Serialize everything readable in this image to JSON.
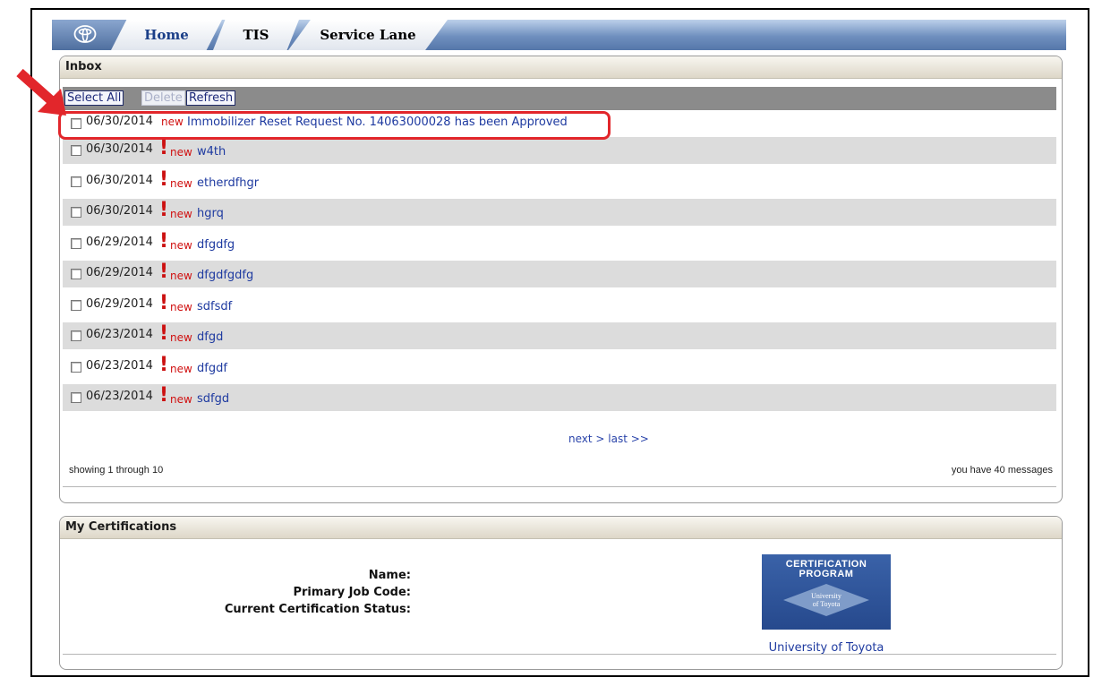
{
  "nav": {
    "logo_icon": "toyota-logo-icon",
    "tabs": [
      {
        "label": "Home",
        "active": true
      },
      {
        "label": "TIS",
        "active": false
      },
      {
        "label": "Service Lane",
        "active": false
      }
    ]
  },
  "inbox": {
    "title": "Inbox",
    "toolbar": {
      "select_all": "Select All",
      "delete": "Delete",
      "refresh": "Refresh"
    },
    "messages": [
      {
        "date": "06/30/2014",
        "badge": "new",
        "priority": "",
        "subject": "Immobilizer Reset Request No. 14063000028 has been Approved"
      },
      {
        "date": "06/30/2014",
        "badge": "new",
        "priority": "!",
        "subject": "w4th"
      },
      {
        "date": "06/30/2014",
        "badge": "new",
        "priority": "!",
        "subject": "etherdfhgr"
      },
      {
        "date": "06/30/2014",
        "badge": "new",
        "priority": "!",
        "subject": "hgrq"
      },
      {
        "date": "06/29/2014",
        "badge": "new",
        "priority": "!",
        "subject": "dfgdfg"
      },
      {
        "date": "06/29/2014",
        "badge": "new",
        "priority": "!",
        "subject": "dfgdfgdfg"
      },
      {
        "date": "06/29/2014",
        "badge": "new",
        "priority": "!",
        "subject": "sdfsdf"
      },
      {
        "date": "06/23/2014",
        "badge": "new",
        "priority": "!",
        "subject": "dfgd"
      },
      {
        "date": "06/23/2014",
        "badge": "new",
        "priority": "!",
        "subject": "dfgdf"
      },
      {
        "date": "06/23/2014",
        "badge": "new",
        "priority": "!",
        "subject": "sdfgd"
      }
    ],
    "pager": "next > last >>",
    "showing": "showing 1 through 10",
    "count": "you have 40 messages"
  },
  "certifications": {
    "title": "My Certifications",
    "labels": {
      "name": "Name:",
      "job_code": "Primary Job Code:",
      "status": "Current Certification Status:"
    },
    "badge": {
      "line1": "CERTIFICATION",
      "line2": "PROGRAM",
      "sub1": "University",
      "sub2": "of Toyota"
    },
    "link": "University of Toyota"
  },
  "annotation": {
    "arrow_color": "#e2262b",
    "highlight_color": "#e2262b"
  }
}
